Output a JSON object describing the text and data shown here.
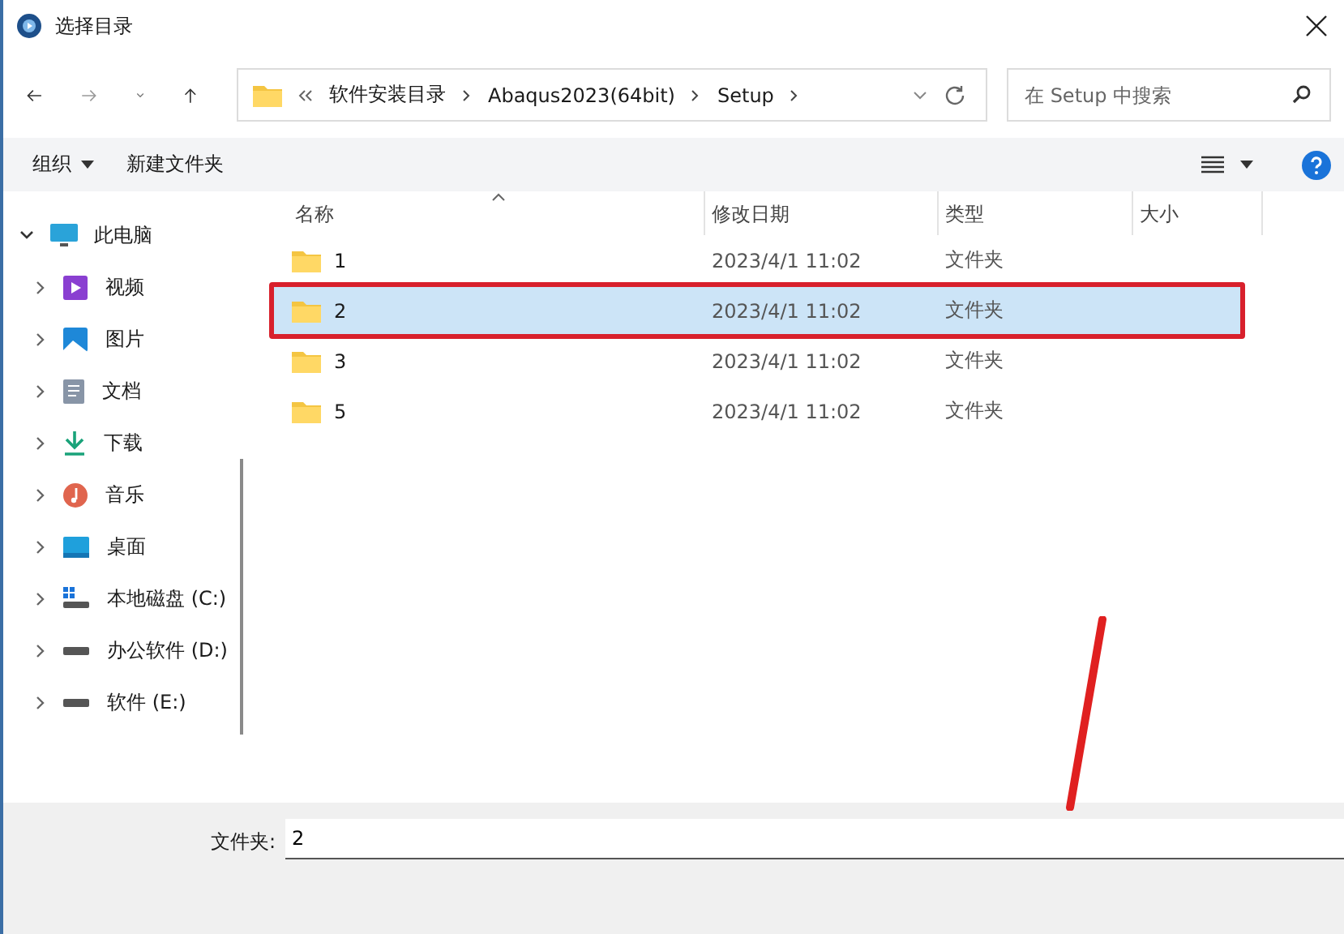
{
  "window": {
    "title": "选择目录"
  },
  "address": {
    "crumbs": [
      "软件安装目录",
      "Abaqus2023(64bit)",
      "Setup"
    ]
  },
  "search": {
    "placeholder": "在 Setup 中搜索"
  },
  "toolbar": {
    "organize": "组织",
    "new_folder": "新建文件夹"
  },
  "sidebar": {
    "root": {
      "label": "此电脑",
      "expanded": true
    },
    "items": [
      {
        "label": "视频",
        "kind": "video"
      },
      {
        "label": "图片",
        "kind": "pictures"
      },
      {
        "label": "文档",
        "kind": "documents"
      },
      {
        "label": "下载",
        "kind": "downloads"
      },
      {
        "label": "音乐",
        "kind": "music"
      },
      {
        "label": "桌面",
        "kind": "desktop"
      },
      {
        "label": "本地磁盘 (C:)",
        "kind": "system-drive"
      },
      {
        "label": "办公软件 (D:)",
        "kind": "drive"
      },
      {
        "label": "软件 (E:)",
        "kind": "drive"
      }
    ]
  },
  "table": {
    "columns": [
      "名称",
      "修改日期",
      "类型",
      "大小"
    ],
    "rows": [
      {
        "name": "1",
        "modified": "2023/4/1 11:02",
        "type": "文件夹",
        "selected": false,
        "annotated": false
      },
      {
        "name": "2",
        "modified": "2023/4/1 11:02",
        "type": "文件夹",
        "selected": true,
        "annotated": true
      },
      {
        "name": "3",
        "modified": "2023/4/1 11:02",
        "type": "文件夹",
        "selected": false,
        "annotated": false
      },
      {
        "name": "5",
        "modified": "2023/4/1 11:02",
        "type": "文件夹",
        "selected": false,
        "annotated": false
      }
    ]
  },
  "folder_field": {
    "label": "文件夹:",
    "value": "2"
  }
}
